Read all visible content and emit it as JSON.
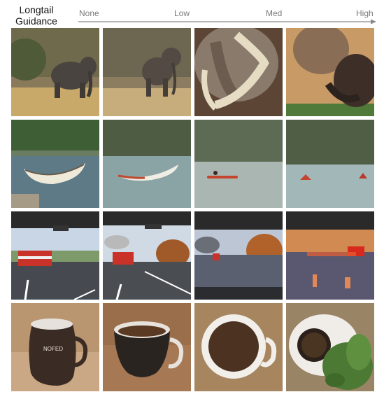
{
  "header": {
    "title_line1": "Longtail",
    "title_line2": "Guidance",
    "levels": [
      "None",
      "Low",
      "Med",
      "High"
    ]
  },
  "rows": [
    {
      "subject": "elephant",
      "cells": [
        "elephant-none",
        "elephant-low",
        "elephant-med",
        "elephant-high"
      ]
    },
    {
      "subject": "canoe",
      "cells": [
        "canoe-none",
        "canoe-low",
        "canoe-med",
        "canoe-high"
      ]
    },
    {
      "subject": "fire-truck",
      "cells": [
        "firetruck-none",
        "firetruck-low",
        "firetruck-med",
        "firetruck-high"
      ]
    },
    {
      "subject": "coffee-mug",
      "cells": [
        "mug-none",
        "mug-low",
        "mug-med",
        "mug-high"
      ]
    }
  ],
  "colors": {
    "arrow": "#888888",
    "level_text": "#7a7a7a"
  }
}
